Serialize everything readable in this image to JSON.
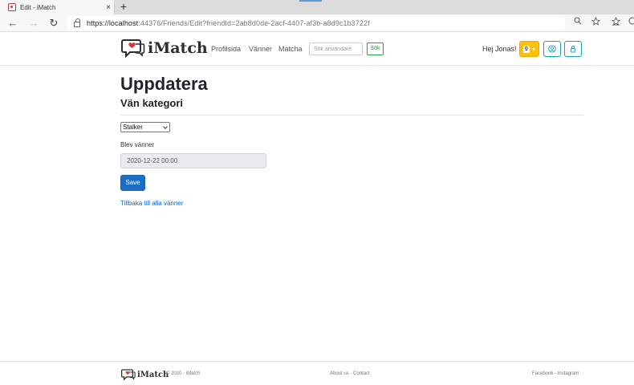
{
  "browser": {
    "tab_title": "Edit - iMatch",
    "tab_close": "×",
    "new_tab": "+",
    "url_host": "https://localhost",
    "url_path": ":44376/Friends/Edit?friendId=2ab8d0de-2acf-4407-af3b-a8d9c1b3722f",
    "back": "←",
    "forward": "→",
    "reload": "↻"
  },
  "navbar": {
    "brand": "iMatch",
    "links": [
      "Profilsida",
      "Vänner",
      "Matcha"
    ],
    "search_placeholder": "Sök användare",
    "search_button": "Sök",
    "greeting": "Hej Jonas!",
    "notification_count": "0"
  },
  "main": {
    "title": "Uppdatera",
    "subtitle": "Vän kategori",
    "category_selected": "Stalker",
    "date_label": "Blev vänner",
    "date_value": "2020-12-22 00:00",
    "save_label": "Save",
    "back_link": "Tillbaka till alla vänner"
  },
  "footer": {
    "brand": "iMatch",
    "copyright": "© 2020 - iMatch",
    "about": "About us",
    "separator": " - ",
    "contact": "Contact",
    "facebook": "Facebook",
    "instagram": "Instagram"
  },
  "colors": {
    "primary": "#1b6ec2",
    "success": "#28a745",
    "warning": "#ffc107",
    "info": "#17a2b8",
    "logo_heart": "#d9383a"
  }
}
